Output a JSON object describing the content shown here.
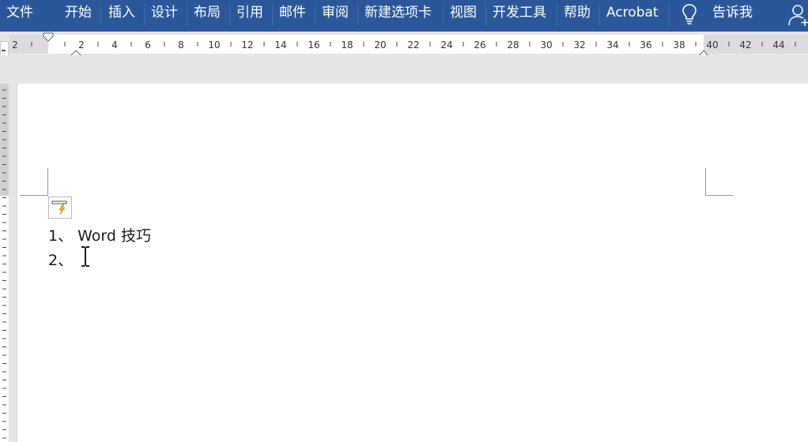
{
  "ribbon": {
    "background": "#2b579a",
    "tabs": [
      {
        "label": "文件"
      },
      {
        "label": "开始"
      },
      {
        "label": "插入"
      },
      {
        "label": "设计"
      },
      {
        "label": "布局"
      },
      {
        "label": "引用"
      },
      {
        "label": "邮件"
      },
      {
        "label": "审阅"
      },
      {
        "label": "新建选项卡"
      },
      {
        "label": "视图"
      },
      {
        "label": "开发工具"
      },
      {
        "label": "帮助"
      },
      {
        "label": "Acrobat"
      }
    ],
    "tell_me_icon": "lightbulb-icon",
    "tell_me_label": "告诉我",
    "share_icon": "add-user-icon"
  },
  "ruler": {
    "numbers": [
      "2",
      "2",
      "4",
      "6",
      "8",
      "10",
      "12",
      "14",
      "16",
      "18",
      "20",
      "22",
      "24",
      "26",
      "28",
      "30",
      "32",
      "34",
      "36",
      "38",
      "40",
      "42",
      "44"
    ]
  },
  "document": {
    "lines": [
      "1、 Word 技巧",
      "2、"
    ]
  }
}
